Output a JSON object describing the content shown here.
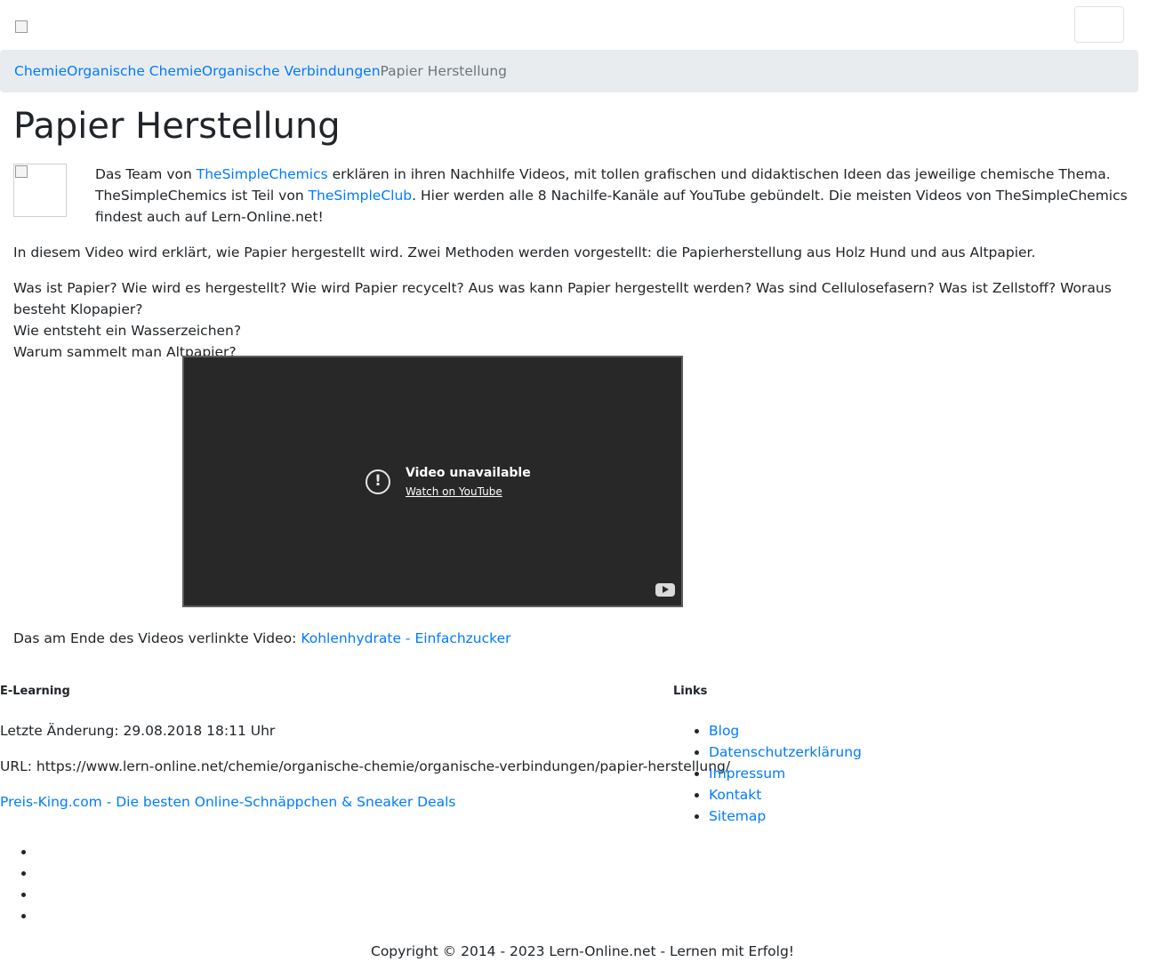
{
  "breadcrumb": {
    "items": [
      "Chemie",
      "Organische Chemie",
      "Organische Verbindungen"
    ],
    "current": "Papier Herstellung"
  },
  "page": {
    "title": "Papier Herstellung"
  },
  "intro": {
    "text1": "Das Team von ",
    "link1": "TheSimpleChemics",
    "text2": " erklären in ihren Nachhilfe Videos, mit tollen grafischen und didaktischen Ideen das jeweilige chemische Thema. TheSimpleChemics ist Teil von ",
    "link2": "TheSimpleClub",
    "text3": ". Hier werden alle 8 Nachilfe-Kanäle auf YouTube gebündelt. Die meisten Videos von TheSimpleChemics findest auch auf Lern-Online.net!"
  },
  "content": {
    "description": "In diesem Video wird erklärt, wie Papier hergestellt wird. Zwei Methoden werden vorgestellt: die Papierherstellung aus Holz Hund und aus Altpapier.",
    "questions": [
      "Was ist Papier? Wie wird es hergestellt? Wie wird Papier recycelt? Aus was kann Papier hergestellt werden? Was sind Cellulosefasern? Was ist Zellstoff? Woraus besteht Klopapier?",
      "Wie entsteht ein Wasserzeichen?",
      "Warum sammelt man Altpapier?"
    ]
  },
  "video": {
    "title": "Video unavailable",
    "link": "Watch on YouTube"
  },
  "linked_video": {
    "prefix": "Das am Ende des Videos verlinkte Video: ",
    "link": "Kohlenhydrate - Einfachzucker"
  },
  "footer": {
    "elearning_heading": "E-Learning",
    "last_change": "Letzte Änderung: 29.08.2018 18:11 Uhr",
    "url": "URL: https://www.lern-online.net/chemie/organische-chemie/organische-verbindungen/papier-herstellung/",
    "ad_link": "Preis-King.com - Die besten Online-Schnäppchen & Sneaker Deals",
    "links_heading": "Links",
    "links": [
      "Blog",
      "Datenschutzerklärung",
      "Impressum",
      "Kontakt",
      "Sitemap"
    ],
    "copyright": "Copyright © 2014 - 2023 Lern-Online.net - Lernen mit Erfolg!"
  }
}
